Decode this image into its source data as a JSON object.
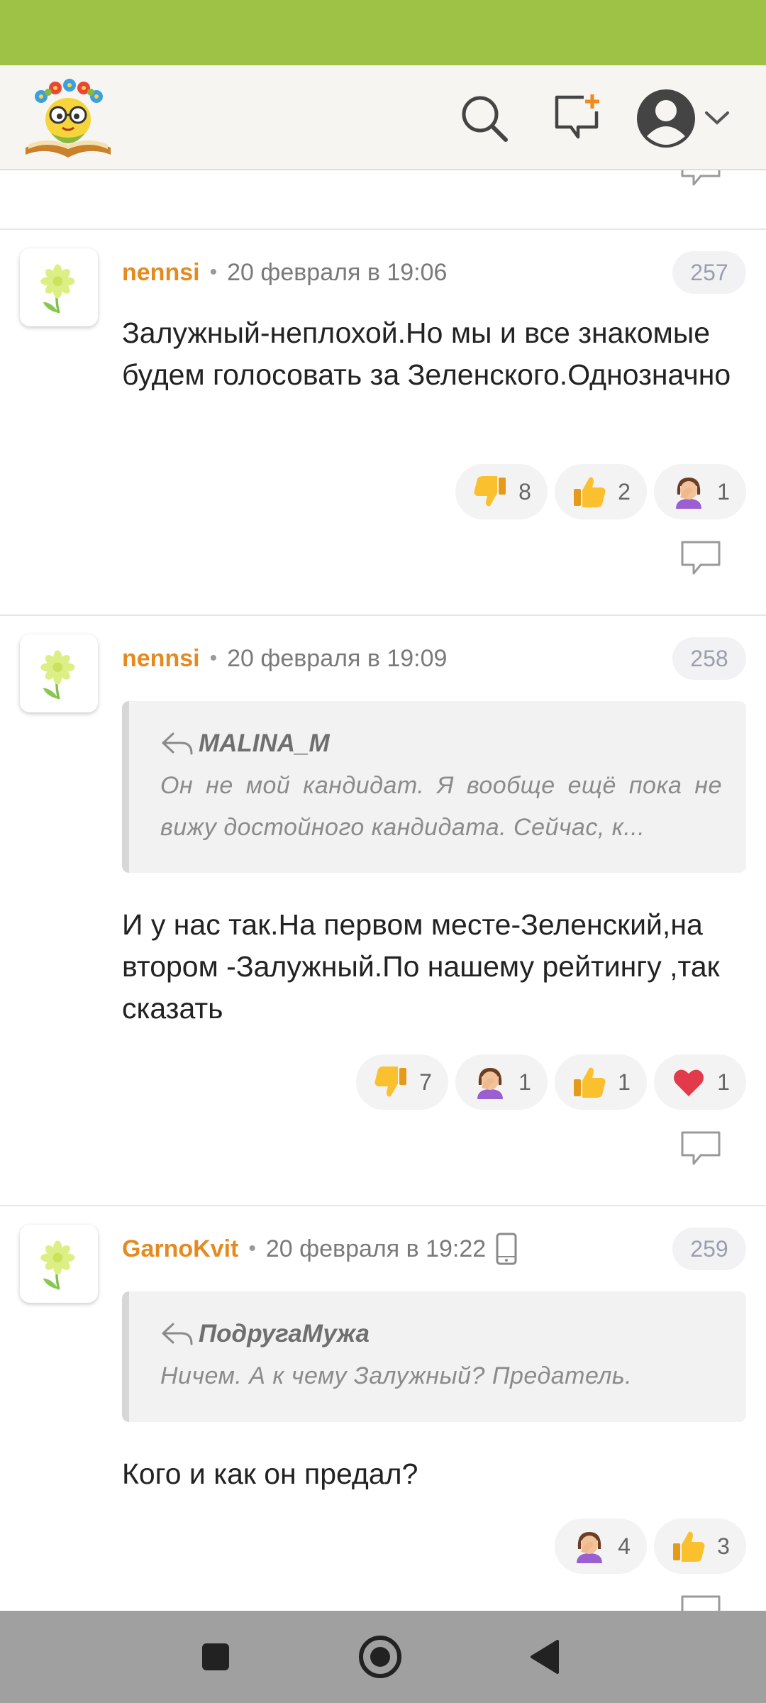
{
  "theme": {
    "status_bar_color": "#9dc245",
    "app_bar_color": "#f6f5f1",
    "author_color": "#e58a1f",
    "nav_bar_color": "#a0a0a0"
  },
  "header": {
    "icons": [
      "logo",
      "search-icon",
      "new-message-icon",
      "user-avatar-icon",
      "chevron-down-icon"
    ]
  },
  "comments": [
    {
      "author": "nennsi",
      "separator": "•",
      "date": "20 февраля в 19:06",
      "number": "257",
      "text": "Залужный-неплохой.Но мы и все знакомые будем голосовать за Зеленского.Однозначно",
      "reactions": [
        {
          "emoji": "thumbs-down",
          "count": "8"
        },
        {
          "emoji": "thumbs-up",
          "count": "2"
        },
        {
          "emoji": "facepalm",
          "count": "1"
        }
      ]
    },
    {
      "author": "nennsi",
      "separator": "•",
      "date": "20 февраля в 19:09",
      "number": "258",
      "quote": {
        "author": "MALINA_M",
        "text": "Он не мой кандидат. Я вообще ещё пока не вижу достойного кандидата. Сейчас, к..."
      },
      "text": "И у нас так.На первом месте-Зеленский,на втором -Залужный.По нашему рейтингу ,так сказать",
      "reactions": [
        {
          "emoji": "thumbs-down",
          "count": "7"
        },
        {
          "emoji": "facepalm",
          "count": "1"
        },
        {
          "emoji": "thumbs-up",
          "count": "1"
        },
        {
          "emoji": "heart",
          "count": "1"
        }
      ]
    },
    {
      "author": "GarnoKvit",
      "separator": "•",
      "date": "20 февраля в 19:22",
      "device_icon": "mobile-phone-icon",
      "number": "259",
      "quote": {
        "author": "ПодругаМужа",
        "text": "Ничем. А к чему Залужный? Предатель."
      },
      "text": "Кого и как он предал?",
      "reactions": [
        {
          "emoji": "facepalm",
          "count": "4"
        },
        {
          "emoji": "thumbs-up",
          "count": "3"
        }
      ]
    }
  ],
  "navigation": {
    "buttons": [
      "recent-apps",
      "home",
      "back"
    ]
  }
}
